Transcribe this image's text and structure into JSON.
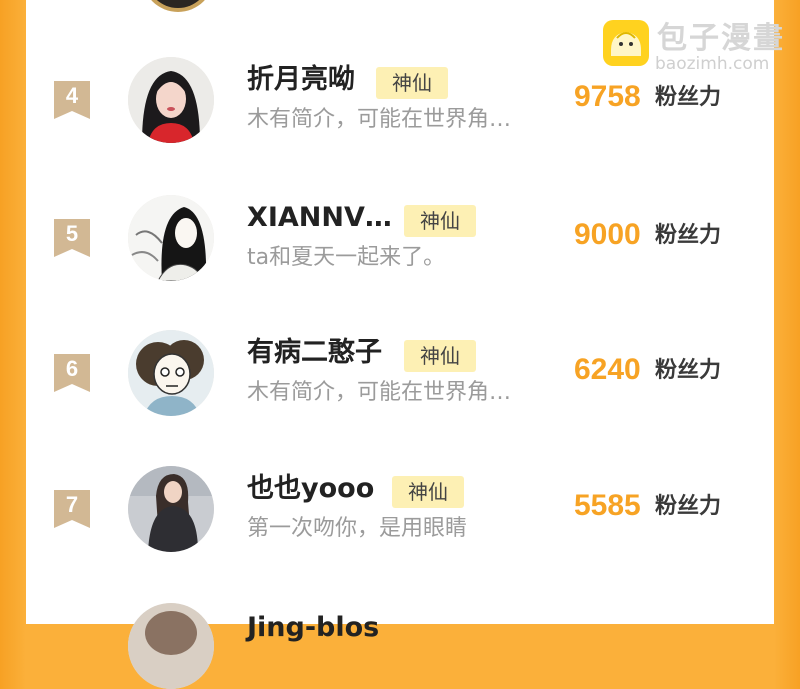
{
  "watermark": {
    "title": "包子漫畫",
    "url": "baozimh.com"
  },
  "fans_label": "粉丝力",
  "entries": [
    {
      "rank": "4",
      "name": "折月亮呦",
      "badge": "神仙",
      "bio": "木有简介，可能在世界角…",
      "fans": "9758"
    },
    {
      "rank": "5",
      "name": "XIANNV…",
      "badge": "神仙",
      "bio": "ta和夏天一起来了。",
      "fans": "9000"
    },
    {
      "rank": "6",
      "name": "有病二憨子",
      "badge": "神仙",
      "bio": "木有简介，可能在世界角…",
      "fans": "6240"
    },
    {
      "rank": "7",
      "name": "也也yooo",
      "badge": "神仙",
      "bio": "第一次吻你，是用眼睛",
      "fans": "5585"
    }
  ],
  "next_entry": {
    "name": "Jing-blos"
  },
  "colors": {
    "accent": "#f7a324",
    "badge_bg": "#fdf0b4",
    "frame": "#fbb03a",
    "rank_badge": "#d2b894"
  }
}
